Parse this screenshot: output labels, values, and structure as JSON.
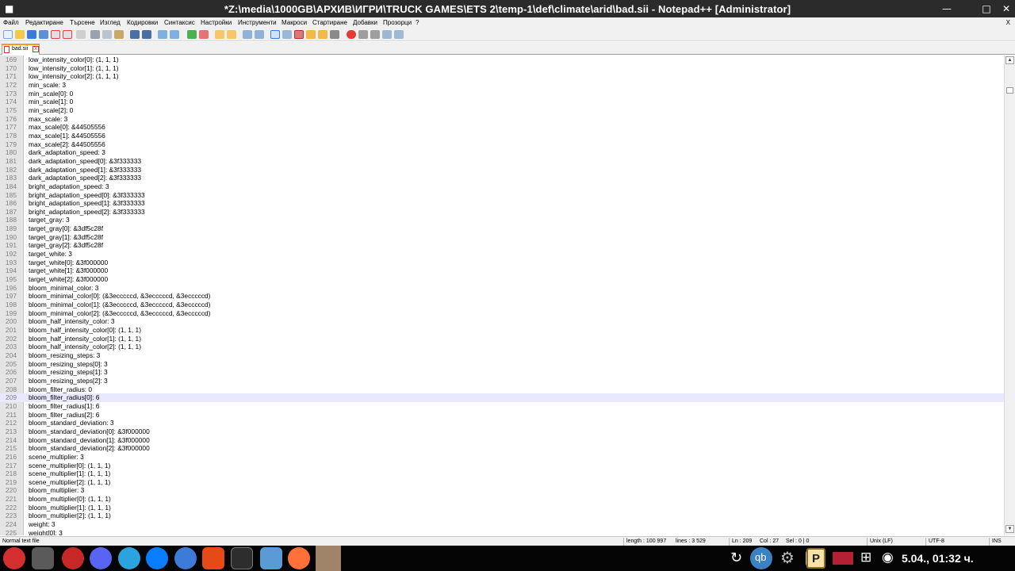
{
  "window": {
    "title": "*Z:\\media\\1000GB\\АРХИВ\\ИГРИ\\TRUCK GAMES\\ETS 2\\temp-1\\def\\climate\\arid\\bad.sii - Notepad++ [Administrator]",
    "minimize_icon": "minimize-icon",
    "maximize_icon": "maximize-icon",
    "close_icon": "close-icon"
  },
  "menu": {
    "items": [
      "Файл",
      "Редактиране",
      "Търсене",
      "Изглед",
      "Кодировки",
      "Синтаксис",
      "Настройки",
      "Инструменти",
      "Макроси",
      "Стартиране",
      "Добавки",
      "Прозорци",
      "?"
    ],
    "close": "X"
  },
  "toolbar": {
    "icons": [
      "new-file-icon",
      "open-file-icon",
      "save-icon",
      "save-all-icon",
      "close-icon",
      "close-all-icon",
      "print-icon",
      "cut-icon",
      "copy-icon",
      "paste-icon",
      "undo-icon",
      "redo-icon",
      "find-icon",
      "replace-icon",
      "zoom-in-icon",
      "zoom-out-icon",
      "sync-vertical-icon",
      "sync-horizontal-icon",
      "word-wrap-icon",
      "show-all-chars-icon",
      "indent-guide-icon",
      "language-icon",
      "doc-map-icon",
      "function-list-icon",
      "folder-workspace-icon",
      "monitoring-icon",
      "record-macro-icon",
      "stop-record-icon",
      "play-macro-icon",
      "run-macro-multiple-icon",
      "save-macro-icon"
    ]
  },
  "tab": {
    "name": "bad.sii"
  },
  "editor": {
    "current_line": 209,
    "lines": [
      {
        "n": "169",
        "t": "low_intensity_color[0]: (1, 1, 1)"
      },
      {
        "n": "170",
        "t": "low_intensity_color[1]: (1, 1, 1)"
      },
      {
        "n": "171",
        "t": "low_intensity_color[2]: (1, 1, 1)"
      },
      {
        "n": "172",
        "t": "min_scale: 3"
      },
      {
        "n": "173",
        "t": "min_scale[0]: 0"
      },
      {
        "n": "174",
        "t": "min_scale[1]: 0"
      },
      {
        "n": "175",
        "t": "min_scale[2]: 0"
      },
      {
        "n": "176",
        "t": "max_scale: 3"
      },
      {
        "n": "177",
        "t": "max_scale[0]: &44505556"
      },
      {
        "n": "178",
        "t": "max_scale[1]: &44505556"
      },
      {
        "n": "179",
        "t": "max_scale[2]: &44505556"
      },
      {
        "n": "180",
        "t": "dark_adaptation_speed: 3"
      },
      {
        "n": "181",
        "t": "dark_adaptation_speed[0]: &3f333333"
      },
      {
        "n": "182",
        "t": "dark_adaptation_speed[1]: &3f333333"
      },
      {
        "n": "183",
        "t": "dark_adaptation_speed[2]: &3f333333"
      },
      {
        "n": "184",
        "t": "bright_adaptation_speed: 3"
      },
      {
        "n": "185",
        "t": "bright_adaptation_speed[0]: &3f333333"
      },
      {
        "n": "186",
        "t": "bright_adaptation_speed[1]: &3f333333"
      },
      {
        "n": "187",
        "t": "bright_adaptation_speed[2]: &3f333333"
      },
      {
        "n": "188",
        "t": "target_gray: 3"
      },
      {
        "n": "189",
        "t": "target_gray[0]: &3df5c28f"
      },
      {
        "n": "190",
        "t": "target_gray[1]: &3df5c28f"
      },
      {
        "n": "191",
        "t": "target_gray[2]: &3df5c28f"
      },
      {
        "n": "192",
        "t": "target_white: 3"
      },
      {
        "n": "193",
        "t": "target_white[0]: &3f000000"
      },
      {
        "n": "194",
        "t": "target_white[1]: &3f000000"
      },
      {
        "n": "195",
        "t": "target_white[2]: &3f000000"
      },
      {
        "n": "196",
        "t": "bloom_minimal_color: 3"
      },
      {
        "n": "197",
        "t": "bloom_minimal_color[0]: (&3ecccccd, &3ecccccd, &3ecccccd)"
      },
      {
        "n": "198",
        "t": "bloom_minimal_color[1]: (&3ecccccd, &3ecccccd, &3ecccccd)"
      },
      {
        "n": "199",
        "t": "bloom_minimal_color[2]: (&3ecccccd, &3ecccccd, &3ecccccd)"
      },
      {
        "n": "200",
        "t": "bloom_half_intensity_color: 3"
      },
      {
        "n": "201",
        "t": "bloom_half_intensity_color[0]: (1, 1, 1)"
      },
      {
        "n": "202",
        "t": "bloom_half_intensity_color[1]: (1, 1, 1)"
      },
      {
        "n": "203",
        "t": "bloom_half_intensity_color[2]: (1, 1, 1)"
      },
      {
        "n": "204",
        "t": "bloom_resizing_steps: 3"
      },
      {
        "n": "205",
        "t": "bloom_resizing_steps[0]: 3"
      },
      {
        "n": "206",
        "t": "bloom_resizing_steps[1]: 3"
      },
      {
        "n": "207",
        "t": "bloom_resizing_steps[2]: 3"
      },
      {
        "n": "208",
        "t": "bloom_filter_radius: 0"
      },
      {
        "n": "209",
        "t": "bloom_filter_radius[0]: 6"
      },
      {
        "n": "210",
        "t": "bloom_filter_radius[1]: 6"
      },
      {
        "n": "211",
        "t": "bloom_filter_radius[2]: 6"
      },
      {
        "n": "212",
        "t": "bloom_standard_deviation: 3"
      },
      {
        "n": "213",
        "t": "bloom_standard_deviation[0]: &3f000000"
      },
      {
        "n": "214",
        "t": "bloom_standard_deviation[1]: &3f000000"
      },
      {
        "n": "215",
        "t": "bloom_standard_deviation[2]: &3f000000"
      },
      {
        "n": "216",
        "t": "scene_multiplier: 3"
      },
      {
        "n": "217",
        "t": "scene_multiplier[0]: (1, 1, 1)"
      },
      {
        "n": "218",
        "t": "scene_multiplier[1]: (1, 1, 1)"
      },
      {
        "n": "219",
        "t": "scene_multiplier[2]: (1, 1, 1)"
      },
      {
        "n": "220",
        "t": "bloom_multiplier: 3"
      },
      {
        "n": "221",
        "t": "bloom_multiplier[0]: (1, 1, 1)"
      },
      {
        "n": "222",
        "t": "bloom_multiplier[1]: (1, 1, 1)"
      },
      {
        "n": "223",
        "t": "bloom_multiplier[2]: (1, 1, 1)"
      },
      {
        "n": "224",
        "t": "weight: 3"
      },
      {
        "n": "225",
        "t": "weight[0]: 3"
      }
    ]
  },
  "status": {
    "file_type": "Normal text file",
    "length": "length : 100 997",
    "lines": "lines : 3 529",
    "ln": "Ln : 209",
    "col": "Col : 27",
    "sel": "Sel : 0 | 0",
    "eol": "Unix (LF)",
    "encoding": "UTF-8",
    "mode": "INS"
  },
  "taskbar": {
    "apps": [
      "start-menu-icon",
      "calculator-icon",
      "language-flag-icon",
      "discord-icon",
      "telegram-icon",
      "messenger-icon",
      "mail-icon",
      "gedit-icon",
      "terminal-icon",
      "file-manager-icon",
      "firefox-icon",
      "notepadpp-task-icon"
    ],
    "tray": [
      "refresh-icon",
      "qbittorrent-icon",
      "settings-gear-icon",
      "usb-icon",
      "notepad-tray-icon",
      "us-flag-icon",
      "network-icon",
      "record-icon"
    ],
    "tray_qb": "qb",
    "tray_p": "P",
    "clock": "5.04., 01:32 ч."
  },
  "colors": {
    "titlebar": "#2b2b2b",
    "current_line": "#e8e8ff",
    "tab_accent": "#f59a23",
    "taskbar": "#050505"
  }
}
